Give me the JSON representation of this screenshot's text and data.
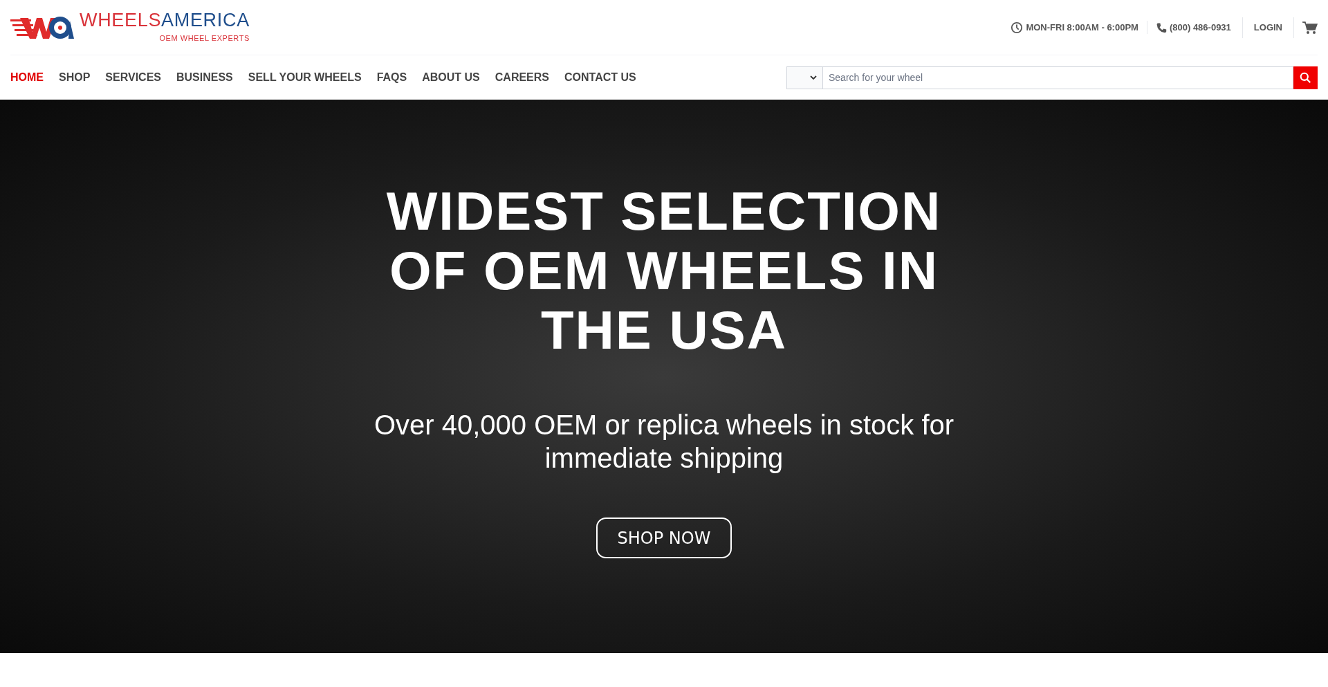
{
  "logo": {
    "word_1": "WHEELS",
    "word_2": "AMERICA",
    "tagline": "OEM WHEEL EXPERTS"
  },
  "top_bar": {
    "hours": "MON-FRI 8:00AM - 6:00PM",
    "phone": "(800) 486-0931",
    "login": "LOGIN"
  },
  "nav": [
    {
      "label": "HOME",
      "selected": true
    },
    {
      "label": "SHOP",
      "selected": false
    },
    {
      "label": "SERVICES",
      "selected": false
    },
    {
      "label": "BUSINESS",
      "selected": false
    },
    {
      "label": "SELL YOUR WHEELS",
      "selected": false
    },
    {
      "label": "FAQS",
      "selected": false
    },
    {
      "label": "ABOUT US",
      "selected": false
    },
    {
      "label": "CAREERS",
      "selected": false
    },
    {
      "label": "CONTACT US",
      "selected": false
    }
  ],
  "search": {
    "placeholder": "Search for your wheel"
  },
  "hero": {
    "title": "WIDEST SELECTION OF OEM WHEELS IN THE USA",
    "subtitle": "Over 40,000 OEM or replica wheels in stock for immediate shipping",
    "button": "SHOP NOW"
  }
}
